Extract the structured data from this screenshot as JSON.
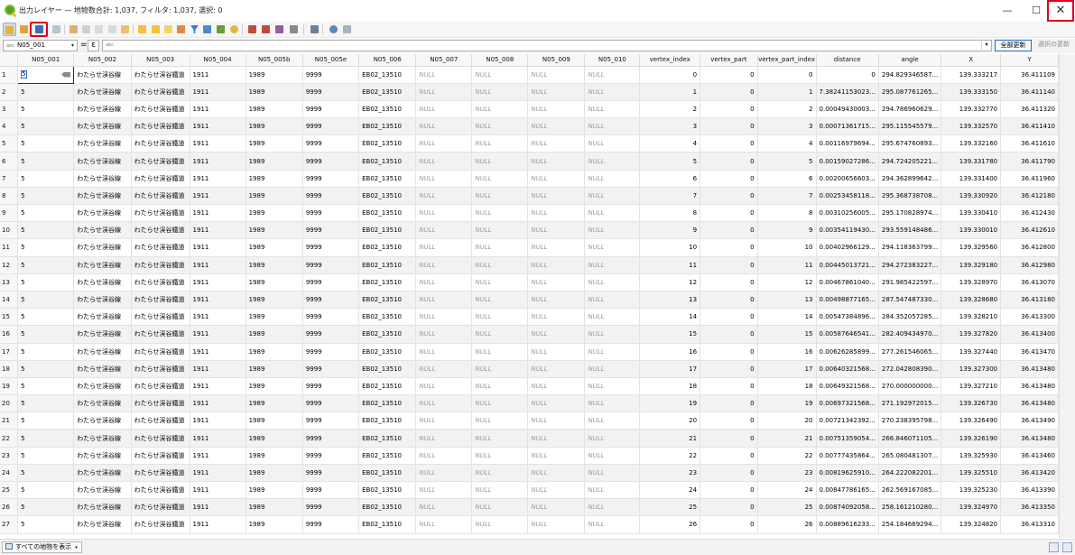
{
  "window": {
    "title": "出力レイヤー — 地物数合計: 1,037, フィルタ: 1,037, 選択: 0",
    "minimize": "—",
    "maximize": "☐",
    "close": "✕"
  },
  "toolbar": {
    "icons": [
      "pencil-edit-icon",
      "multi-edit-icon",
      "save-edits-icon",
      "reload-icon",
      "add-feature-icon",
      "delete-feature-icon",
      "cut-icon",
      "copy-icon",
      "paste-icon",
      "expression-select-icon",
      "select-all-icon",
      "invert-selection-icon",
      "deselect-icon",
      "filter-selected-icon",
      "move-selected-top-icon",
      "pan-to-selected-icon",
      "zoom-to-selected-icon",
      "new-field-icon",
      "delete-field-icon",
      "field-calculator-icon",
      "conditional-formatting-icon",
      "actions-icon",
      "dock-icon",
      "zoom-map-icon"
    ]
  },
  "filter": {
    "field": "N05_001",
    "field_type": "abc",
    "equals": "=",
    "epsilon": "ε",
    "expression_type": "abc",
    "dropdown_arrow": "▾",
    "update_all": "全部更新",
    "update_selected": "選択の更新"
  },
  "table": {
    "columns": [
      "N05_001",
      "N05_002",
      "N05_003",
      "N05_004",
      "N05_005b",
      "N05_005e",
      "N05_006",
      "N05_007",
      "N05_008",
      "N05_009",
      "N05_010",
      "vertex_index",
      "vertex_part",
      "vertex_part_index",
      "distance",
      "angle",
      "X",
      "Y"
    ],
    "null_text": "NULL",
    "common": {
      "n05_001": "5",
      "n05_002": "わたらせ渓谷線",
      "n05_003": "わたらせ渓谷鐵道",
      "n05_004": "1911",
      "n05_005b": "1989",
      "n05_005e": "9999",
      "n05_006": "EB02_13510",
      "vertex_part": "0"
    },
    "rows": [
      {
        "num": "1",
        "vertex_index": "0",
        "vertex_part_index": "0",
        "distance": "0",
        "angle": "294.829346587...",
        "x": "139.333217",
        "y": "36.411109"
      },
      {
        "num": "2",
        "vertex_index": "1",
        "vertex_part_index": "1",
        "distance": "7.38241153023...",
        "angle": "295.087761265...",
        "x": "139.333150",
        "y": "36.411140"
      },
      {
        "num": "3",
        "vertex_index": "2",
        "vertex_part_index": "2",
        "distance": "0.00049430003...",
        "angle": "294.786960629...",
        "x": "139.332770",
        "y": "36.411320"
      },
      {
        "num": "4",
        "vertex_index": "3",
        "vertex_part_index": "3",
        "distance": "0.00071361715...",
        "angle": "295.115545579...",
        "x": "139.332570",
        "y": "36.411410"
      },
      {
        "num": "5",
        "vertex_index": "4",
        "vertex_part_index": "4",
        "distance": "0.00116979694...",
        "angle": "295.674760893...",
        "x": "139.332160",
        "y": "36.411610"
      },
      {
        "num": "6",
        "vertex_index": "5",
        "vertex_part_index": "5",
        "distance": "0.00159027286...",
        "angle": "294.724205221...",
        "x": "139.331780",
        "y": "36.411790"
      },
      {
        "num": "7",
        "vertex_index": "6",
        "vertex_part_index": "6",
        "distance": "0.00200656603...",
        "angle": "294.362899642...",
        "x": "139.331400",
        "y": "36.411960"
      },
      {
        "num": "8",
        "vertex_index": "7",
        "vertex_part_index": "7",
        "distance": "0.00253458118...",
        "angle": "295.368738708...",
        "x": "139.330920",
        "y": "36.412180"
      },
      {
        "num": "9",
        "vertex_index": "8",
        "vertex_part_index": "8",
        "distance": "0.00310256005...",
        "angle": "295.170828974...",
        "x": "139.330410",
        "y": "36.412430"
      },
      {
        "num": "10",
        "vertex_index": "9",
        "vertex_part_index": "9",
        "distance": "0.00354119430...",
        "angle": "293.559148486...",
        "x": "139.330010",
        "y": "36.412610"
      },
      {
        "num": "11",
        "vertex_index": "10",
        "vertex_part_index": "10",
        "distance": "0.00402966129...",
        "angle": "294.118363799...",
        "x": "139.329560",
        "y": "36.412800"
      },
      {
        "num": "12",
        "vertex_index": "11",
        "vertex_part_index": "11",
        "distance": "0.00445013721...",
        "angle": "294.272383227...",
        "x": "139.329180",
        "y": "36.412980"
      },
      {
        "num": "13",
        "vertex_index": "12",
        "vertex_part_index": "12",
        "distance": "0.00467861040...",
        "angle": "291.985422597...",
        "x": "139.328970",
        "y": "36.413070"
      },
      {
        "num": "14",
        "vertex_index": "13",
        "vertex_part_index": "13",
        "distance": "0.00498877165...",
        "angle": "287.547487330...",
        "x": "139.328680",
        "y": "36.413180"
      },
      {
        "num": "15",
        "vertex_index": "14",
        "vertex_part_index": "14",
        "distance": "0.00547384896...",
        "angle": "284.352057285...",
        "x": "139.328210",
        "y": "36.413300"
      },
      {
        "num": "16",
        "vertex_index": "15",
        "vertex_part_index": "15",
        "distance": "0.00587646541...",
        "angle": "282.409434970...",
        "x": "139.327820",
        "y": "36.413400"
      },
      {
        "num": "17",
        "vertex_index": "16",
        "vertex_part_index": "16",
        "distance": "0.00626285899...",
        "angle": "277.261546065...",
        "x": "139.327440",
        "y": "36.413470"
      },
      {
        "num": "18",
        "vertex_index": "17",
        "vertex_part_index": "17",
        "distance": "0.00640321568...",
        "angle": "272.042808390...",
        "x": "139.327300",
        "y": "36.413480"
      },
      {
        "num": "19",
        "vertex_index": "18",
        "vertex_part_index": "18",
        "distance": "0.00649321568...",
        "angle": "270.000000000...",
        "x": "139.327210",
        "y": "36.413480"
      },
      {
        "num": "20",
        "vertex_index": "19",
        "vertex_part_index": "19",
        "distance": "0.00697321568...",
        "angle": "271.192972015...",
        "x": "139.326730",
        "y": "36.413480"
      },
      {
        "num": "21",
        "vertex_index": "20",
        "vertex_part_index": "20",
        "distance": "0.00721342392...",
        "angle": "270.238395798...",
        "x": "139.326490",
        "y": "36.413490"
      },
      {
        "num": "22",
        "vertex_index": "21",
        "vertex_part_index": "21",
        "distance": "0.00751359054...",
        "angle": "266.846071105...",
        "x": "139.326190",
        "y": "36.413480"
      },
      {
        "num": "23",
        "vertex_index": "22",
        "vertex_part_index": "22",
        "distance": "0.00777435864...",
        "angle": "265.080481307...",
        "x": "139.325930",
        "y": "36.413460"
      },
      {
        "num": "24",
        "vertex_index": "23",
        "vertex_part_index": "23",
        "distance": "0.00819625910...",
        "angle": "264.222082201...",
        "x": "139.325510",
        "y": "36.413420"
      },
      {
        "num": "25",
        "vertex_index": "24",
        "vertex_part_index": "24",
        "distance": "0.00847786165...",
        "angle": "262.569167085...",
        "x": "139.325230",
        "y": "36.413390"
      },
      {
        "num": "26",
        "vertex_index": "25",
        "vertex_part_index": "25",
        "distance": "0.00874092058...",
        "angle": "258.161210280...",
        "x": "139.324970",
        "y": "36.413350"
      },
      {
        "num": "27",
        "vertex_index": "26",
        "vertex_part_index": "26",
        "distance": "0.00889616233...",
        "angle": "254.184669294...",
        "x": "139.324820",
        "y": "36.413310"
      }
    ]
  },
  "bottombar": {
    "show_all": "すべての地物を表示",
    "dropdown_arrow": "▾"
  }
}
